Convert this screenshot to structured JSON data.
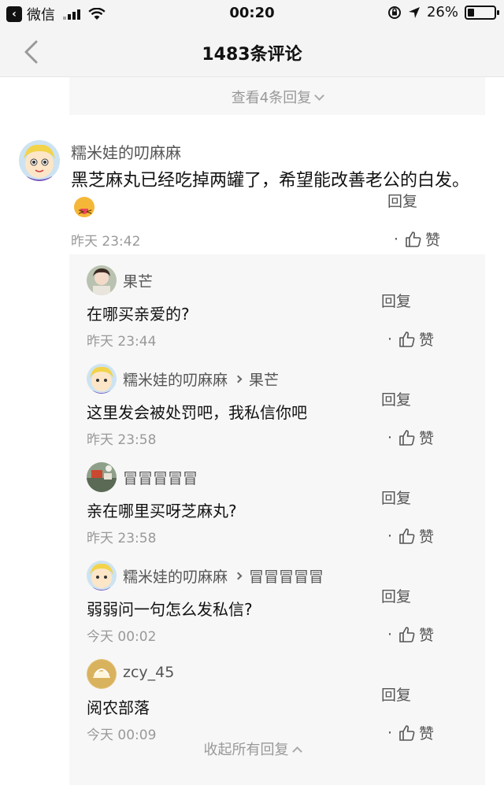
{
  "status_bar": {
    "back_app_label": "微信",
    "time": "00:20",
    "battery": "26%",
    "battery_level": 0.26
  },
  "nav": {
    "title": "1483条评论"
  },
  "top_more": {
    "label": "查看4条回复"
  },
  "main_comment": {
    "user": "糯米娃的叨麻麻",
    "text": "黑芝麻丸已经吃掉两罐了，希望能改善老公的白发。",
    "emoji": "squinting-tongue-emoji",
    "time": "昨天 23:42",
    "reply_label": "回复",
    "dot": "·",
    "like_label": "赞"
  },
  "replies": [
    {
      "user": "果芒",
      "to": "",
      "text": "在哪买亲爱的?",
      "time": "昨天 23:44",
      "reply_label": "回复",
      "dot": "·",
      "like_label": "赞"
    },
    {
      "user": "糯米娃的叨麻麻",
      "to": "果芒",
      "text": "这里发会被处罚吧，我私信你吧",
      "time": "昨天 23:58",
      "reply_label": "回复",
      "dot": "·",
      "like_label": "赞"
    },
    {
      "user": "冒冒冒冒冒",
      "to": "",
      "text": "亲在哪里买呀芝麻丸?",
      "time": "昨天 23:58",
      "reply_label": "回复",
      "dot": "·",
      "like_label": "赞"
    },
    {
      "user": "糯米娃的叨麻麻",
      "to": "冒冒冒冒冒",
      "text": "弱弱问一句怎么发私信?",
      "time": "今天 00:02",
      "reply_label": "回复",
      "dot": "·",
      "like_label": "赞"
    },
    {
      "user": "zcy_45",
      "to": "",
      "text": "阅农部落",
      "time": "今天 00:09",
      "reply_label": "回复",
      "dot": "·",
      "like_label": "赞"
    }
  ],
  "collapse": {
    "label": "收起所有回复"
  }
}
